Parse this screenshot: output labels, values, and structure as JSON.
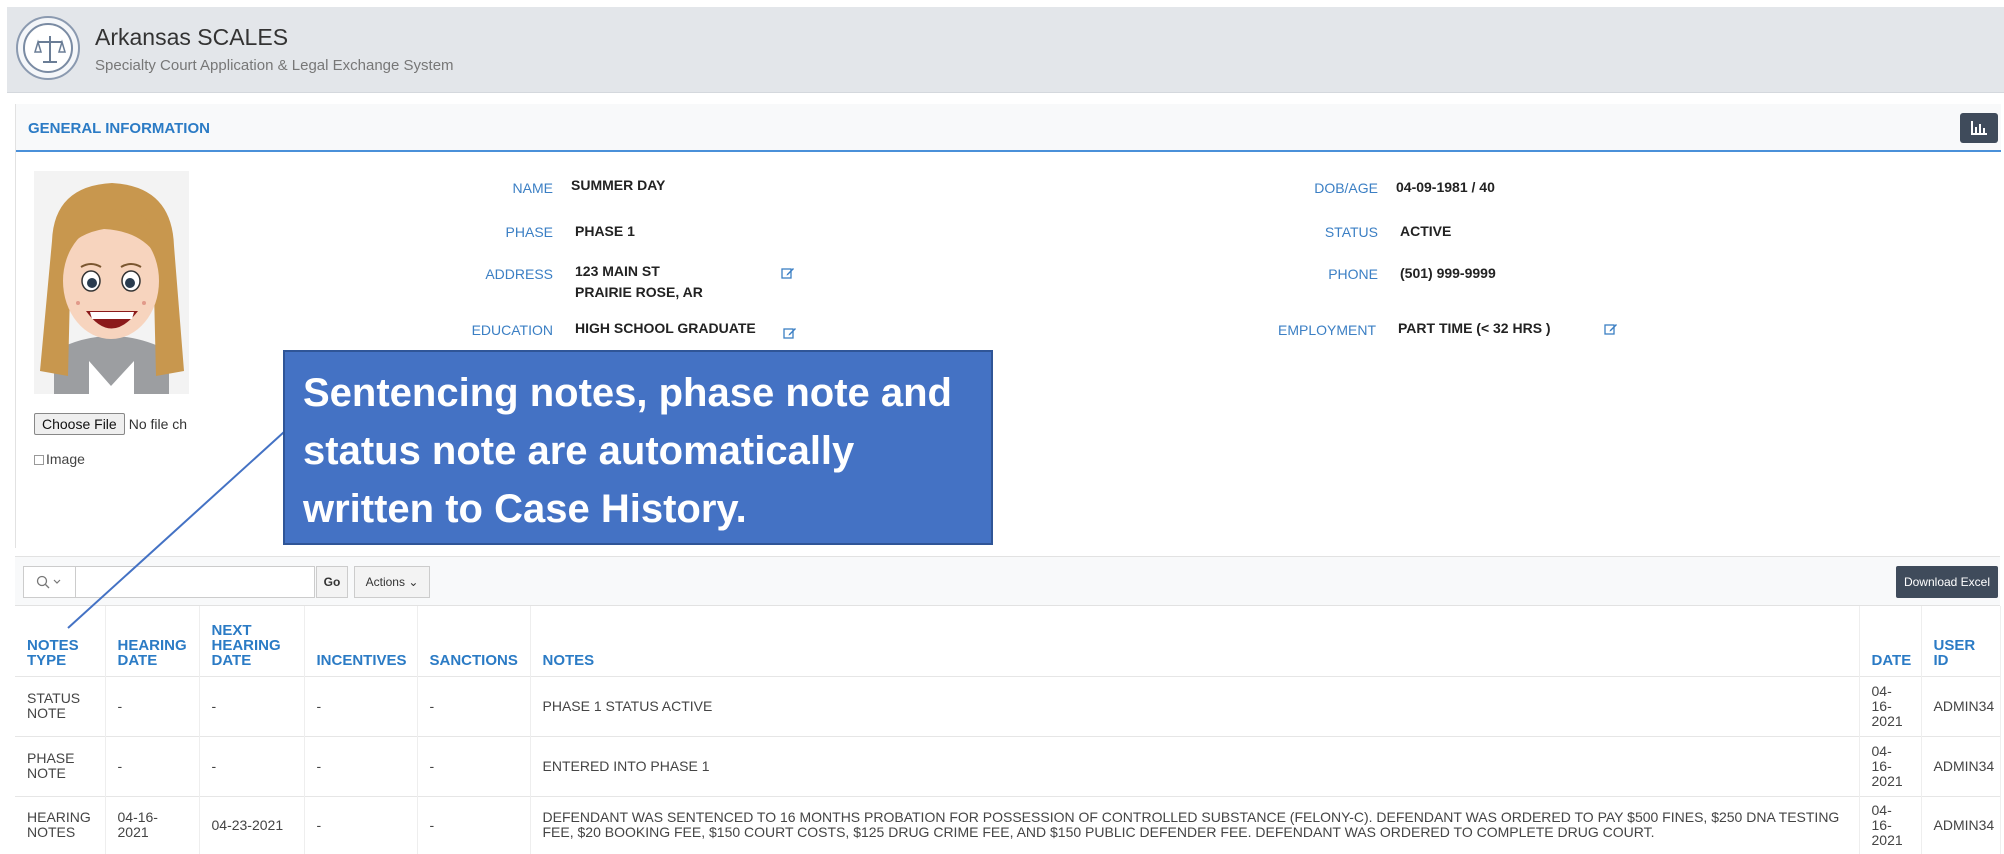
{
  "header": {
    "title": "Arkansas SCALES",
    "subtitle": "Specialty Court Application & Legal Exchange System"
  },
  "general_info": {
    "title": "GENERAL INFORMATION",
    "name_label": "NAME",
    "name_value": "SUMMER DAY",
    "phase_label": "PHASE",
    "phase_value": "PHASE 1",
    "address_label": "ADDRESS",
    "address_line1": "123 MAIN ST",
    "address_line2": "PRAIRIE ROSE, AR",
    "education_label": "EDUCATION",
    "education_value": "HIGH SCHOOL GRADUATE",
    "dob_label": "DOB/AGE",
    "dob_value": "04-09-1981 / 40",
    "status_label": "STATUS",
    "status_value": "ACTIVE",
    "phone_label": "PHONE",
    "phone_value": "(501) 999-9999",
    "employment_label": "EMPLOYMENT",
    "employment_value": "PART TIME (< 32 HRS )",
    "choose_file_label": "Choose File",
    "no_file_text": "No file ch",
    "image_alt": "Image"
  },
  "callout": {
    "text": "Sentencing notes, phase note and status note are automatically written to Case History."
  },
  "toolbar": {
    "search_value": "",
    "go_label": "Go",
    "actions_label": "Actions",
    "download_label": "Download Excel"
  },
  "table": {
    "headers": {
      "notes_type": "NOTES TYPE",
      "hearing_date": "HEARING DATE",
      "next_hearing_date": "NEXT HEARING DATE",
      "incentives": "INCENTIVES",
      "sanctions": "SANCTIONS",
      "notes": "NOTES",
      "date": "DATE",
      "user_id": "USER ID"
    },
    "rows": [
      {
        "notes_type": "STATUS NOTE",
        "hearing_date": "-",
        "next_hearing_date": "-",
        "incentives": "-",
        "sanctions": "-",
        "notes": "PHASE 1 STATUS ACTIVE",
        "date": "04-16-2021",
        "user_id": "ADMIN34"
      },
      {
        "notes_type": "PHASE NOTE",
        "hearing_date": "-",
        "next_hearing_date": "-",
        "incentives": "-",
        "sanctions": "-",
        "notes": "ENTERED INTO PHASE 1",
        "date": "04-16-2021",
        "user_id": "ADMIN34"
      },
      {
        "notes_type": "HEARING NOTES",
        "hearing_date": "04-16-2021",
        "next_hearing_date": "04-23-2021",
        "incentives": "-",
        "sanctions": "-",
        "notes": "DEFENDANT WAS SENTENCED TO 16 MONTHS PROBATION FOR POSSESSION OF CONTROLLED SUBSTANCE (FELONY-C). DEFENDANT WAS ORDERED TO PAY $500 FINES, $250 DNA TESTING FEE, $20 BOOKING FEE, $150 COURT COSTS, $125 DRUG CRIME FEE, AND $150 PUBLIC DEFENDER FEE. DEFENDANT WAS ORDERED TO COMPLETE DRUG COURT.",
        "date": "04-16-2021",
        "user_id": "ADMIN34"
      }
    ]
  },
  "colors": {
    "accent": "#2b7bc5",
    "callout": "#4472c4",
    "dark_button": "#3f4b5b"
  }
}
